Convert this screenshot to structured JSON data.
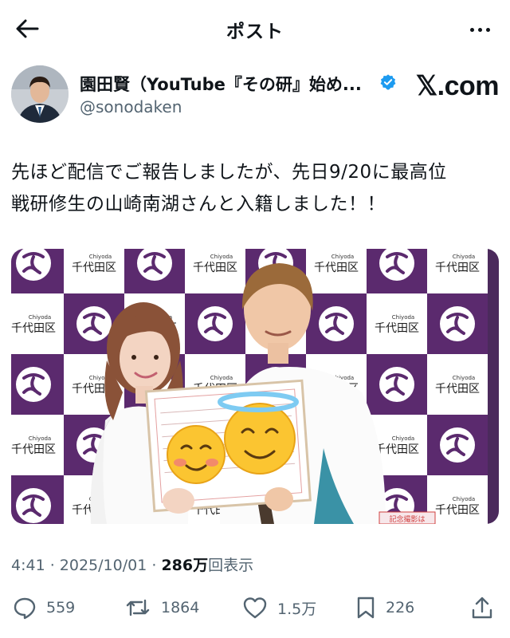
{
  "header": {
    "title": "ポスト",
    "back_icon": "arrow-left-icon",
    "more_icon": "more-horizontal-icon"
  },
  "author": {
    "display_name": "園田賢（YouTube『その研』始め...",
    "handle": "@sonodaken",
    "verified": true,
    "watermark": "𝕏.com"
  },
  "tweet": {
    "lines": [
      "先ほど配信でご報告しましたが、先日9/20に最高位",
      "戦研修生の山崎南湖さんと入籍しました！！"
    ]
  },
  "photo": {
    "backdrop_logo_text": "千代田区",
    "backdrop_logo_roman": "Chiyoda",
    "backdrop_color": "#5b2a6e",
    "sign_text": "記念撮影は"
  },
  "meta": {
    "time": "4:41",
    "sep1": " · ",
    "date": "2025/10/01",
    "sep2": " · ",
    "views_count": "286万",
    "views_label": "回表示"
  },
  "actions": {
    "replies": "559",
    "reposts": "1864",
    "likes": "1.5万",
    "bookmarks": "226"
  },
  "colors": {
    "text": "#0f1419",
    "secondary": "#536471",
    "verified": "#1d9bf0"
  }
}
